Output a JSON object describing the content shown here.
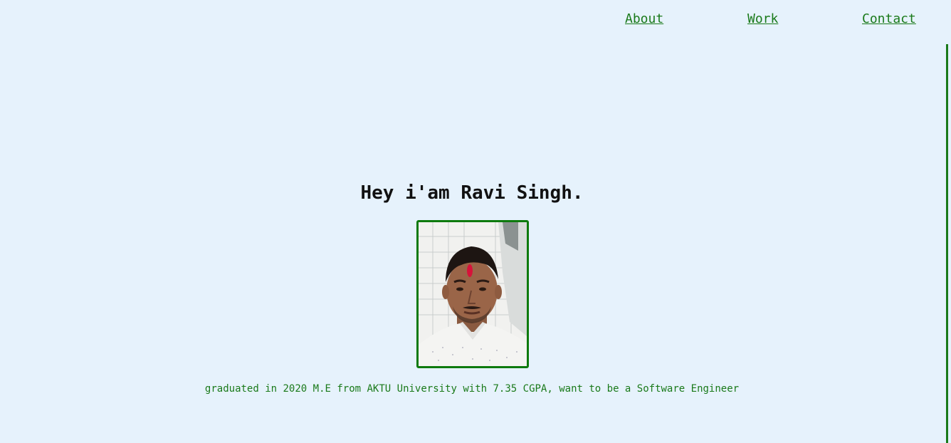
{
  "nav": {
    "about": "About",
    "work": "Work",
    "contact": "Contact"
  },
  "hero": {
    "title": "Hey i'am Ravi Singh.",
    "bio": "graduated in 2020 M.E from AKTU University with 7.35 CGPA, want to be a Software Engineer"
  },
  "colors": {
    "background": "#e6f2fc",
    "accent": "#1a7a1a",
    "frame": "#0d7a0d",
    "title": "#111111"
  }
}
